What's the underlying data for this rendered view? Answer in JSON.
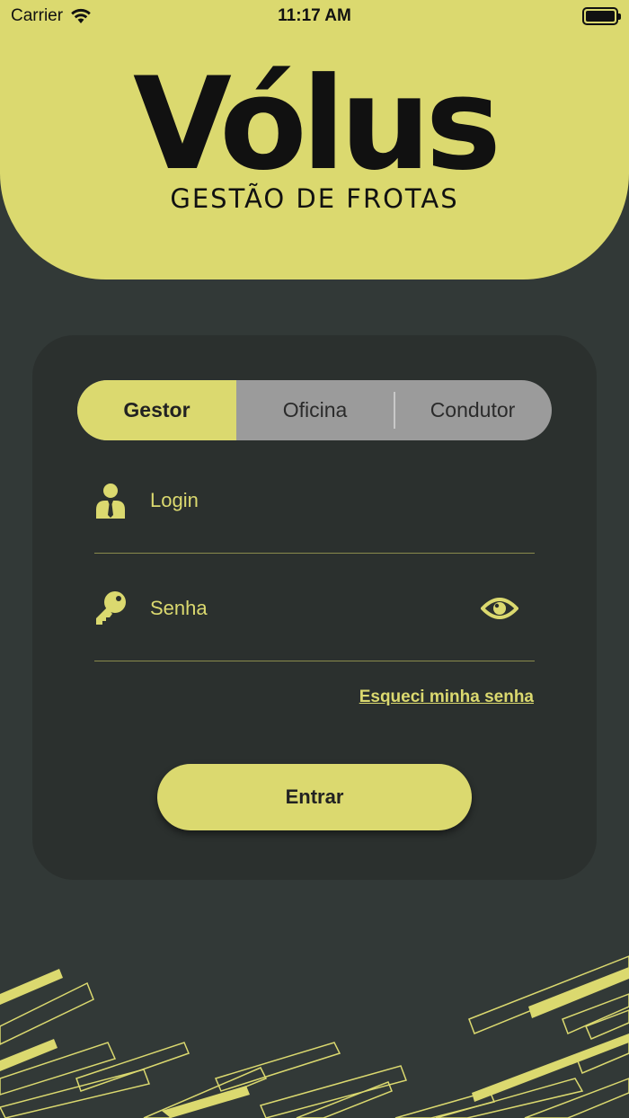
{
  "status_bar": {
    "carrier": "Carrier",
    "time": "11:17 AM"
  },
  "brand": {
    "name": "Vólus",
    "tagline": "GESTÃO DE FROTAS"
  },
  "role_selector": {
    "options": [
      "Gestor",
      "Oficina",
      "Condutor"
    ],
    "selected": "Gestor"
  },
  "login": {
    "placeholder": "Login",
    "value": ""
  },
  "password": {
    "placeholder": "Senha",
    "value": ""
  },
  "forgot_password": "Esqueci minha senha",
  "submit_label": "Entrar",
  "colors": {
    "accent": "#dbd96f",
    "background": "#323937",
    "card": "#2b302e",
    "segment_inactive": "#9b9b9b"
  }
}
